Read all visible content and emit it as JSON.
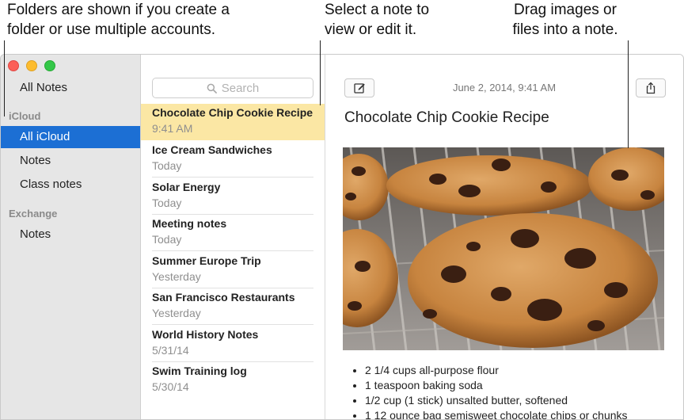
{
  "callouts": {
    "folders": [
      "Folders are shown if you create a",
      "folder or use multiple accounts."
    ],
    "select": [
      "Select a note to",
      "view or edit it."
    ],
    "drag": [
      "Drag images or",
      "files into a note."
    ]
  },
  "sidebar": {
    "all_notes": "All Notes",
    "groups": [
      {
        "label": "iCloud",
        "items": [
          "All iCloud",
          "Notes",
          "Class notes"
        ]
      },
      {
        "label": "Exchange",
        "items": [
          "Notes"
        ]
      }
    ],
    "selected": "All iCloud"
  },
  "list": {
    "search_placeholder": "Search",
    "notes": [
      {
        "title": "Chocolate Chip Cookie Recipe",
        "date": "9:41 AM"
      },
      {
        "title": "Ice Cream Sandwiches",
        "date": "Today"
      },
      {
        "title": "Solar Energy",
        "date": "Today"
      },
      {
        "title": "Meeting notes",
        "date": "Today"
      },
      {
        "title": "Summer Europe Trip",
        "date": "Yesterday"
      },
      {
        "title": "San Francisco Restaurants",
        "date": "Yesterday"
      },
      {
        "title": "World History Notes",
        "date": "5/31/14"
      },
      {
        "title": "Swim Training log",
        "date": "5/30/14"
      }
    ]
  },
  "detail": {
    "date": "June 2, 2014, 9:41 AM",
    "title": "Chocolate Chip Cookie Recipe",
    "ingredients": [
      "2 1/4 cups all-purpose flour",
      "1 teaspoon baking soda",
      "1/2 cup (1 stick) unsalted butter, softened",
      "1 12 ounce bag semisweet chocolate chips or chunks"
    ]
  },
  "icons": {
    "compose": "compose-icon",
    "share": "share-icon",
    "search": "search-icon"
  },
  "colors": {
    "selection_blue": "#1c6fd4",
    "note_highlight": "#fbe7a4"
  }
}
